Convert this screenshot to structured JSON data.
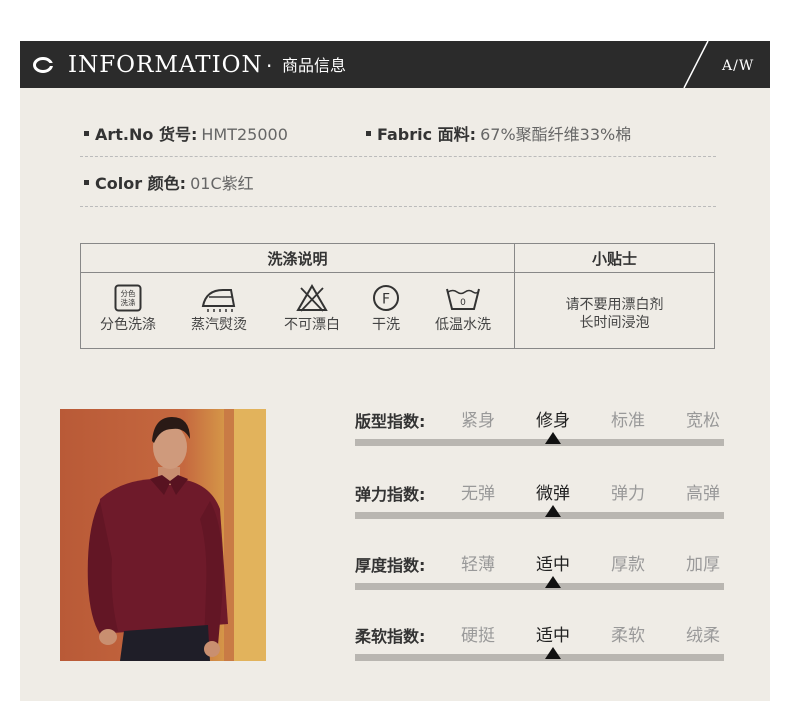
{
  "header": {
    "title": "INFORMATION",
    "separator": "·",
    "subtitle": "商品信息",
    "season": "A/W"
  },
  "specs": {
    "art_no": {
      "label": "Art.No 货号:",
      "value": "HMT25000"
    },
    "fabric": {
      "label": "Fabric 面料:",
      "value": "67%聚酯纤维33%棉"
    },
    "color": {
      "label": "Color  颜色:",
      "value": "01C紫红"
    }
  },
  "care": {
    "title": "洗涤说明",
    "tips_title": "小贴士",
    "tips": [
      "请不要用漂白剂",
      "长时间浸泡"
    ],
    "items": [
      {
        "label": "分色洗涤",
        "icon": "separate-wash-icon",
        "icon_text": [
          "分色",
          "洗涤"
        ]
      },
      {
        "label": "蒸汽熨烫",
        "icon": "steam-iron-icon"
      },
      {
        "label": "不可漂白",
        "icon": "no-bleach-icon"
      },
      {
        "label": "干洗",
        "icon": "dry-clean-icon",
        "icon_text": [
          "F"
        ]
      },
      {
        "label": "低温水洗",
        "icon": "low-temp-wash-icon",
        "icon_text": [
          "0"
        ]
      }
    ]
  },
  "indices": [
    {
      "title": "版型指数:",
      "options": [
        "紧身",
        "修身",
        "标准",
        "宽松"
      ],
      "selected": 1
    },
    {
      "title": "弹力指数:",
      "options": [
        "无弹",
        "微弹",
        "弹力",
        "高弹"
      ],
      "selected": 1
    },
    {
      "title": "厚度指数:",
      "options": [
        "轻薄",
        "适中",
        "厚款",
        "加厚"
      ],
      "selected": 1
    },
    {
      "title": "柔软指数:",
      "options": [
        "硬挺",
        "适中",
        "柔软",
        "绒柔"
      ],
      "selected": 1
    }
  ],
  "colors": {
    "header_bg": "#2b2b2b",
    "panel_bg": "#efece6",
    "bar": "#b9b6b1",
    "marker": "#111111",
    "shirt": "#6e1a2a"
  }
}
